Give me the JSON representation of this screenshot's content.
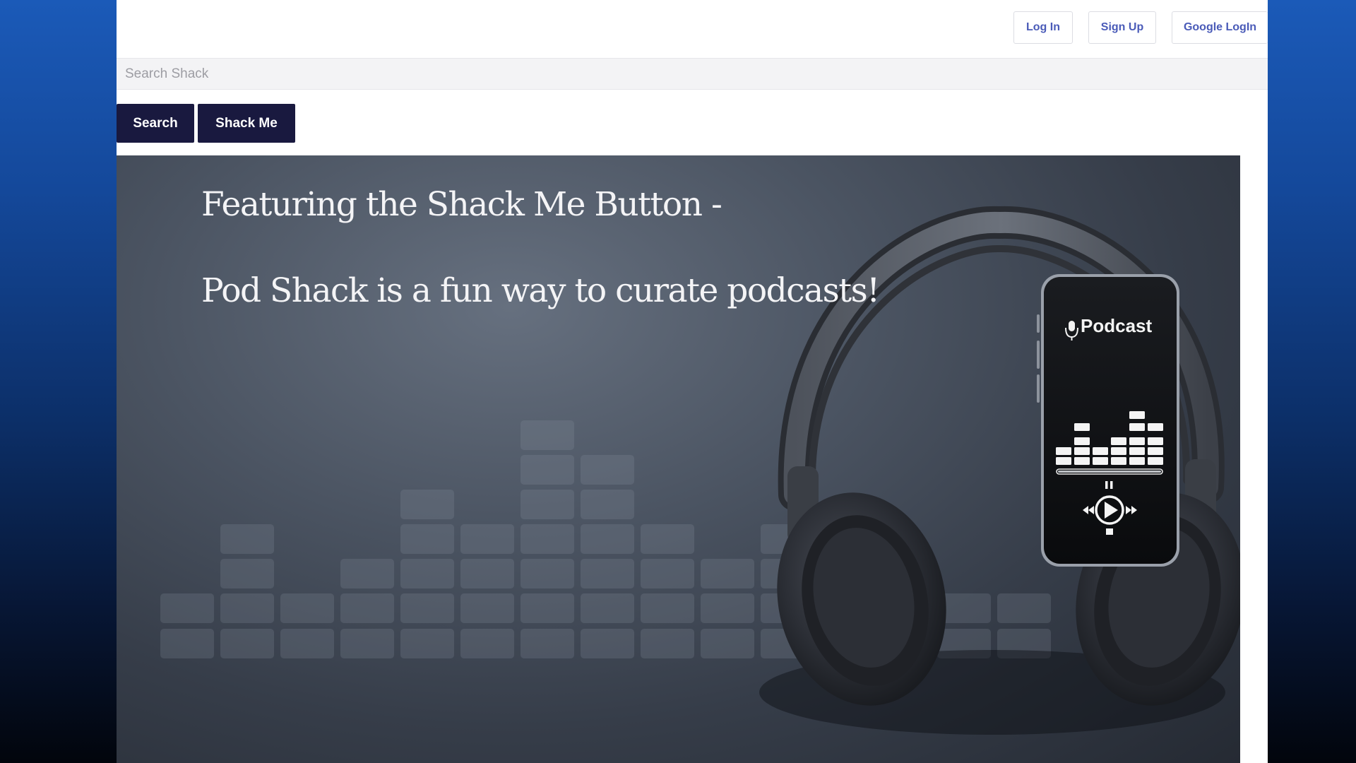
{
  "nav": {
    "login_label": "Log In",
    "signup_label": "Sign Up",
    "google_login_label": "Google LogIn"
  },
  "search": {
    "placeholder": "Search Shack",
    "value": ""
  },
  "actions": {
    "search_label": "Search",
    "shack_me_label": "Shack Me"
  },
  "hero": {
    "line1": "Featuring the Shack Me Button -",
    "line2": "Pod Shack is a fun way to curate podcasts!",
    "phone_app_label": "Podcast"
  },
  "colors": {
    "background_gradient_top": "#1b5ab8",
    "background_gradient_bottom": "#02050c",
    "nav_link": "#4a5bb8",
    "action_button": "#19193f",
    "hero_dark": "#363d49"
  },
  "icons": {
    "microphone": "microphone-icon",
    "play": "play-icon",
    "pause": "pause-icon",
    "rewind": "rewind-icon",
    "fast_forward": "fast-forward-icon",
    "stop": "stop-icon"
  }
}
